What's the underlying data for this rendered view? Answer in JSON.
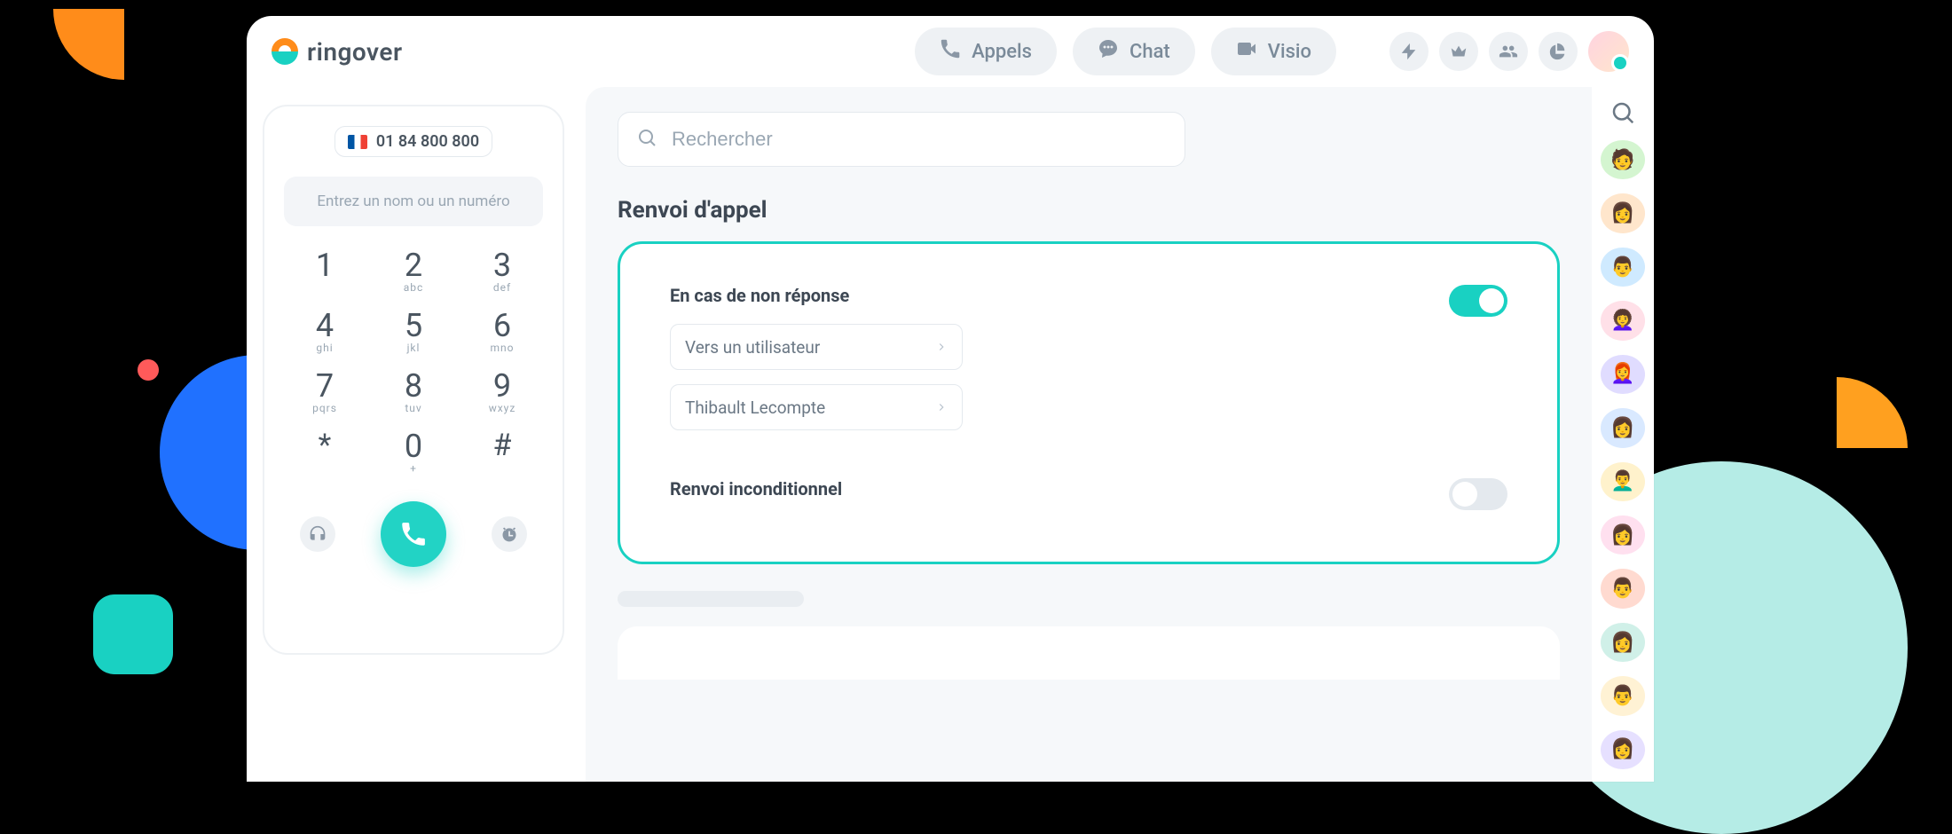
{
  "brand": {
    "name": "ringover"
  },
  "nav": {
    "calls": "Appels",
    "chat": "Chat",
    "video": "Visio"
  },
  "dialer": {
    "number": "01 84 800 800",
    "search_placeholder": "Entrez un nom ou un numéro",
    "keys": [
      {
        "d": "1",
        "l": ""
      },
      {
        "d": "2",
        "l": "abc"
      },
      {
        "d": "3",
        "l": "def"
      },
      {
        "d": "4",
        "l": "ghi"
      },
      {
        "d": "5",
        "l": "jkl"
      },
      {
        "d": "6",
        "l": "mno"
      },
      {
        "d": "7",
        "l": "pqrs"
      },
      {
        "d": "8",
        "l": "tuv"
      },
      {
        "d": "9",
        "l": "wxyz"
      },
      {
        "d": "*",
        "l": ""
      },
      {
        "d": "0",
        "l": "+"
      },
      {
        "d": "#",
        "l": ""
      }
    ]
  },
  "main": {
    "search_placeholder": "Rechercher",
    "section_title": "Renvoi d'appel",
    "no_answer": {
      "title": "En cas de non réponse",
      "select_target": "Vers un utilisateur",
      "select_user": "Thibault Lecompte",
      "enabled": true
    },
    "unconditional": {
      "title": "Renvoi inconditionnel",
      "enabled": false
    }
  }
}
